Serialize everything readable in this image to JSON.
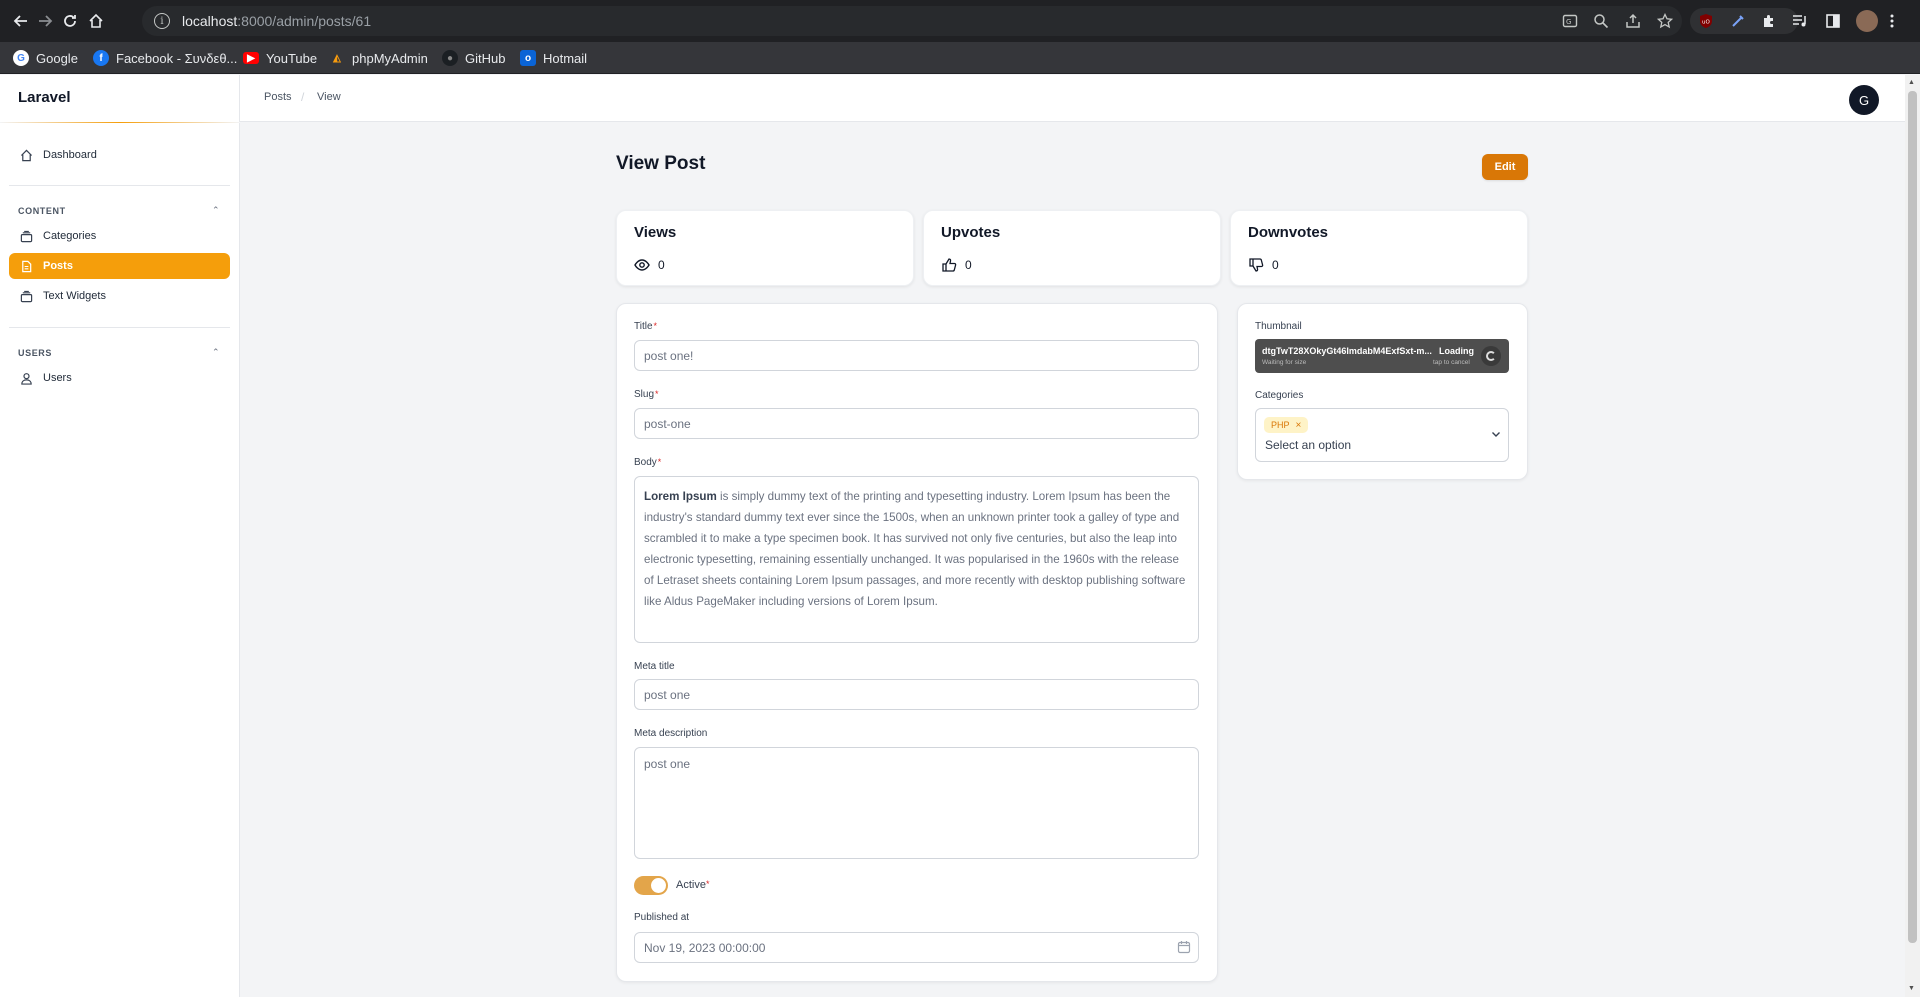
{
  "browser": {
    "url_host": "localhost",
    "url_path": ":8000/admin/posts/61",
    "bookmarks": [
      "Google",
      "Facebook - Συνδεθ...",
      "YouTube",
      "phpMyAdmin",
      "GitHub",
      "Hotmail"
    ]
  },
  "sidebar": {
    "brand": "Laravel",
    "dashboard": "Dashboard",
    "groups": [
      {
        "label": "CONTENT",
        "items": [
          "Categories",
          "Posts",
          "Text Widgets"
        ]
      },
      {
        "label": "USERS",
        "items": [
          "Users"
        ]
      }
    ],
    "active_item": "Posts"
  },
  "topbar": {
    "breadcrumb": [
      "Posts",
      "View"
    ],
    "avatar_initial": "G"
  },
  "page": {
    "title": "View Post",
    "edit_label": "Edit"
  },
  "stats": [
    {
      "label": "Views",
      "value": "0",
      "icon": "eye-icon"
    },
    {
      "label": "Upvotes",
      "value": "0",
      "icon": "thumbs-up-icon"
    },
    {
      "label": "Downvotes",
      "value": "0",
      "icon": "thumbs-down-icon"
    }
  ],
  "form": {
    "title_label": "Title",
    "title_value": "post one!",
    "slug_label": "Slug",
    "slug_value": "post-one",
    "body_label": "Body",
    "body_bold": "Lorem Ipsum",
    "body_text": " is simply dummy text of the printing and typesetting industry. Lorem Ipsum has been the industry's standard dummy text ever since the 1500s, when an unknown printer took a galley of type and scrambled it to make a type specimen book. It has survived not only five centuries, but also the leap into electronic typesetting, remaining essentially unchanged. It was popularised in the 1960s with the release of Letraset sheets containing Lorem Ipsum passages, and more recently with desktop publishing software like Aldus PageMaker including versions of Lorem Ipsum.",
    "meta_title_label": "Meta title",
    "meta_title_value": "post one",
    "meta_description_label": "Meta description",
    "meta_description_value": "post one",
    "active_label": "Active",
    "active_value": true,
    "published_label": "Published at",
    "published_value": "Nov 19, 2023 00:00:00",
    "required_mark": "*"
  },
  "side_form": {
    "thumbnail_label": "Thumbnail",
    "thumbnail_file": "dtgTwT28XOkyGt46ImdabM4ExfSxt-m...",
    "thumbnail_sub": "Waiting for size",
    "thumbnail_status": "Loading",
    "thumbnail_cancel": "tap to cancel",
    "categories_label": "Categories",
    "categories_chip": "PHP",
    "categories_placeholder": "Select an option"
  },
  "colors": {
    "accent": "#f59e0b",
    "edit_button": "#d97706",
    "chip_bg": "#fef3c7"
  }
}
